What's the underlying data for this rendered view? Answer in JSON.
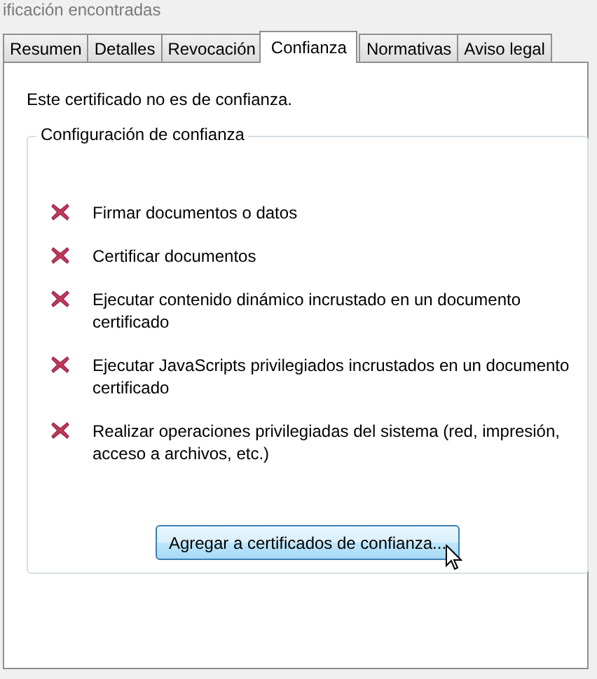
{
  "header": {
    "text": "ificación encontradas"
  },
  "tabs": [
    {
      "label": "Resumen",
      "selected": false
    },
    {
      "label": "Detalles",
      "selected": false
    },
    {
      "label": "Revocación",
      "selected": false
    },
    {
      "label": "Confianza",
      "selected": true
    },
    {
      "label": "Normativas",
      "selected": false
    },
    {
      "label": "Aviso legal",
      "selected": false
    }
  ],
  "status": "Este certificado no es de confianza.",
  "group": {
    "title": "Configuración de confianza",
    "items": [
      {
        "text": "Firmar documentos o datos",
        "allowed": false
      },
      {
        "text": "Certificar documentos",
        "allowed": false
      },
      {
        "text": "Ejecutar contenido dinámico incrustado en un documento certificado",
        "allowed": false
      },
      {
        "text": "Ejecutar JavaScripts privilegiados incrustados en un documento certificado",
        "allowed": false
      },
      {
        "text": "Realizar operaciones privilegiadas del sistema (red, impresión, acceso a archivos, etc.)",
        "allowed": false
      }
    ],
    "button": {
      "label": "Agregar a certificados de confianza...",
      "hovered": true
    }
  }
}
